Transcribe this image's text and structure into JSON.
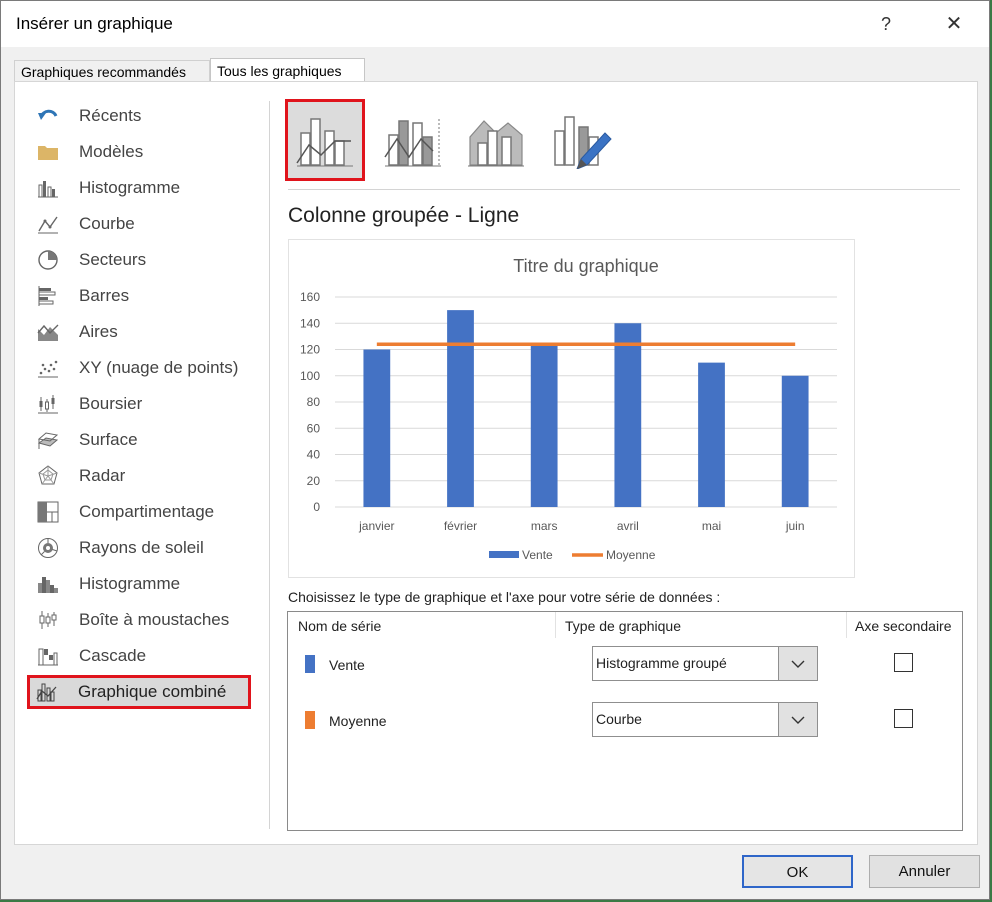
{
  "dialog": {
    "title": "Insérer un graphique",
    "help": "?",
    "close": "✕"
  },
  "tabs": [
    {
      "label": "Graphiques recommandés",
      "active": false
    },
    {
      "label": "Tous les graphiques",
      "active": true
    }
  ],
  "sidebar": {
    "items": [
      {
        "label": "Récents",
        "icon": "undo-arrow-icon"
      },
      {
        "label": "Modèles",
        "icon": "folder-icon"
      },
      {
        "label": "Histogramme",
        "icon": "column-chart-icon"
      },
      {
        "label": "Courbe",
        "icon": "line-chart-icon"
      },
      {
        "label": "Secteurs",
        "icon": "pie-chart-icon"
      },
      {
        "label": "Barres",
        "icon": "bar-chart-icon"
      },
      {
        "label": "Aires",
        "icon": "area-chart-icon"
      },
      {
        "label": "XY (nuage de points)",
        "icon": "scatter-chart-icon"
      },
      {
        "label": "Boursier",
        "icon": "stock-chart-icon"
      },
      {
        "label": "Surface",
        "icon": "surface-chart-icon"
      },
      {
        "label": "Radar",
        "icon": "radar-chart-icon"
      },
      {
        "label": "Compartimentage",
        "icon": "treemap-chart-icon"
      },
      {
        "label": "Rayons de soleil",
        "icon": "sunburst-chart-icon"
      },
      {
        "label": "Histogramme",
        "icon": "histogram-chart-icon"
      },
      {
        "label": "Boîte à moustaches",
        "icon": "box-whisker-chart-icon"
      },
      {
        "label": "Cascade",
        "icon": "waterfall-chart-icon"
      },
      {
        "label": "Graphique combiné",
        "icon": "combo-chart-icon",
        "selected": true
      }
    ]
  },
  "subtypes": {
    "selected_title": "Colonne groupée - Ligne"
  },
  "chart_data": {
    "type": "bar",
    "title": "Titre du graphique",
    "categories": [
      "janvier",
      "février",
      "mars",
      "avril",
      "mai",
      "juin"
    ],
    "series": [
      {
        "name": "Vente",
        "type": "bar",
        "color": "#4472c4",
        "values": [
          120,
          150,
          125,
          140,
          110,
          100
        ]
      },
      {
        "name": "Moyenne",
        "type": "line",
        "color": "#ed7d31",
        "values": [
          124,
          124,
          124,
          124,
          124,
          124
        ]
      }
    ],
    "ylim": [
      0,
      160
    ],
    "yticks": [
      "0",
      "20",
      "40",
      "60",
      "80",
      "100",
      "120",
      "140",
      "160"
    ],
    "grid": true,
    "legend": "bottom"
  },
  "series_config": {
    "instruction": "Choisissez le type de graphique et l'axe pour votre série de données :",
    "headers": {
      "name": "Nom de série",
      "type": "Type de graphique",
      "axis": "Axe secondaire"
    },
    "rows": [
      {
        "name": "Vente",
        "color": "#4472c4",
        "chart_type": "Histogramme groupé",
        "secondary": false
      },
      {
        "name": "Moyenne",
        "color": "#ed7d31",
        "chart_type": "Courbe",
        "secondary": false
      }
    ]
  },
  "buttons": {
    "ok": "OK",
    "cancel": "Annuler"
  }
}
